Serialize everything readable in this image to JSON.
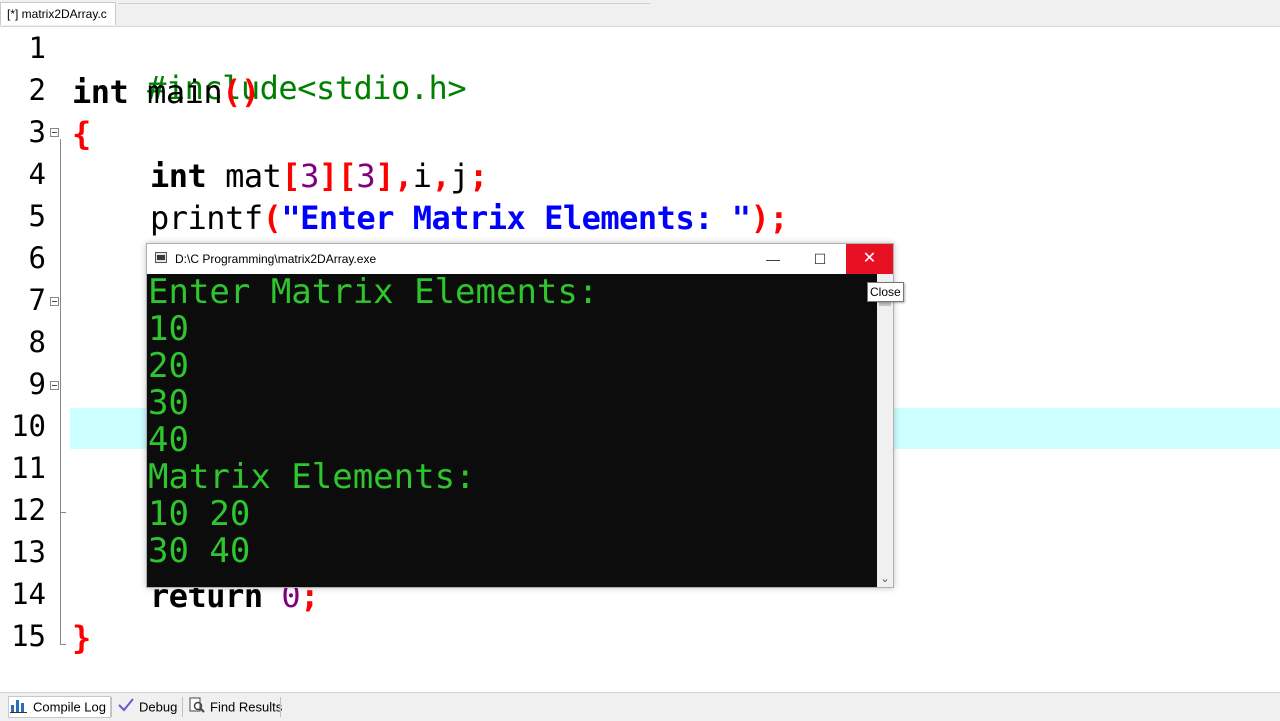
{
  "ide": {
    "tab_title": "[*] matrix2DArray.c"
  },
  "editor": {
    "line_numbers": [
      "1",
      "2",
      "3",
      "4",
      "5",
      "6",
      "7",
      "8",
      "9",
      "10",
      "11",
      "12",
      "13",
      "14",
      "15"
    ],
    "code": {
      "l1_directive": "#include<stdio.h>",
      "l2_kw": "int",
      "l2_name": " main",
      "l2_parens": "()",
      "l3_brace": "{",
      "l4_kw": "int",
      "l4_name": " mat",
      "l4_b1": "[",
      "l4_n1": "3",
      "l4_b2": "][",
      "l4_n2": "3",
      "l4_b3": "],",
      "l4_vars": "i",
      "l4_comma": ",",
      "l4_j": "j",
      "l4_semi": ";",
      "l5_fn": "printf",
      "l5_open": "(",
      "l5_str": "\"Enter Matrix Elements: \"",
      "l5_close": ");",
      "l14_kw": "return",
      "l14_num": "0",
      "l14_semi": ";",
      "l15_brace": "}"
    }
  },
  "console": {
    "title": "D:\\C Programming\\matrix2DArray.exe",
    "close_tooltip": "Close",
    "min_glyph": "—",
    "max_glyph": "☐",
    "close_glyph": "✕",
    "output": [
      "Enter Matrix Elements:",
      "10",
      "20",
      "30",
      "40",
      "Matrix Elements:",
      "10 20",
      "30 40"
    ]
  },
  "bottom_panel": {
    "tabs": [
      {
        "label": "Compile Log",
        "icon": "bar-chart-icon"
      },
      {
        "label": "Debug",
        "icon": "checkmark-icon"
      },
      {
        "label": "Find Results",
        "icon": "find-icon"
      }
    ]
  },
  "colors": {
    "keyword": "#000000",
    "preprocessor": "#008000",
    "symbol": "#ff0000",
    "number": "#800080",
    "string": "#0000ff",
    "current_line": "#ccffff",
    "console_text": "#2ec52e",
    "console_bg": "#0c0c0c",
    "close_button": "#e81123"
  }
}
